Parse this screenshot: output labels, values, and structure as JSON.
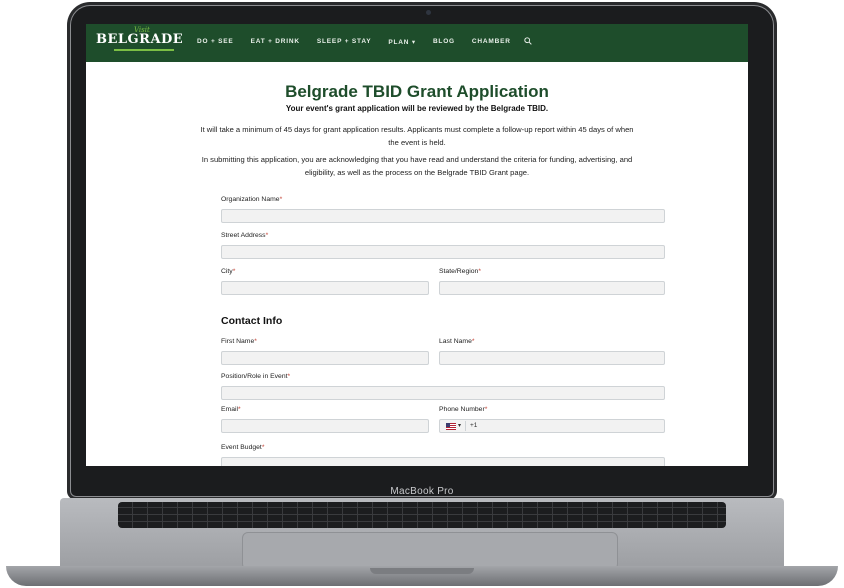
{
  "device": {
    "label": "MacBook Pro"
  },
  "site": {
    "logo": "BELGRADE",
    "logo_visit": "Visit",
    "nav": [
      "DO + SEE",
      "EAT + DRINK",
      "SLEEP + STAY",
      "PLAN ▾",
      "BLOG",
      "CHAMBER"
    ],
    "search_icon": "search-icon"
  },
  "page": {
    "title": "Belgrade TBID Grant Application",
    "subtitle": "Your event's grant application will be reviewed by the Belgrade TBID.",
    "para1": "It will take a minimum of 45 days for grant application results. Applicants must complete a follow-up report within 45 days of when the event is held.",
    "para2": "In submitting this application, you are acknowledging that you have read and understand the criteria for funding, advertising, and eligibility, as well as the process on the Belgrade TBID Grant page."
  },
  "form": {
    "organization_name": {
      "label": "Organization Name",
      "value": ""
    },
    "street_address": {
      "label": "Street Address",
      "value": ""
    },
    "city": {
      "label": "City",
      "value": ""
    },
    "state_region": {
      "label": "State/Region",
      "value": ""
    },
    "contact_heading": "Contact Info",
    "first_name": {
      "label": "First Name",
      "value": ""
    },
    "last_name": {
      "label": "Last Name",
      "value": ""
    },
    "position_role": {
      "label": "Position/Role in Event",
      "value": ""
    },
    "email": {
      "label": "Email",
      "value": ""
    },
    "phone": {
      "label": "Phone Number",
      "country_code": "+1",
      "flag_icon": "us-flag-icon"
    },
    "event_budget": {
      "label": "Event Budget",
      "value": ""
    },
    "required_mark": "*"
  }
}
